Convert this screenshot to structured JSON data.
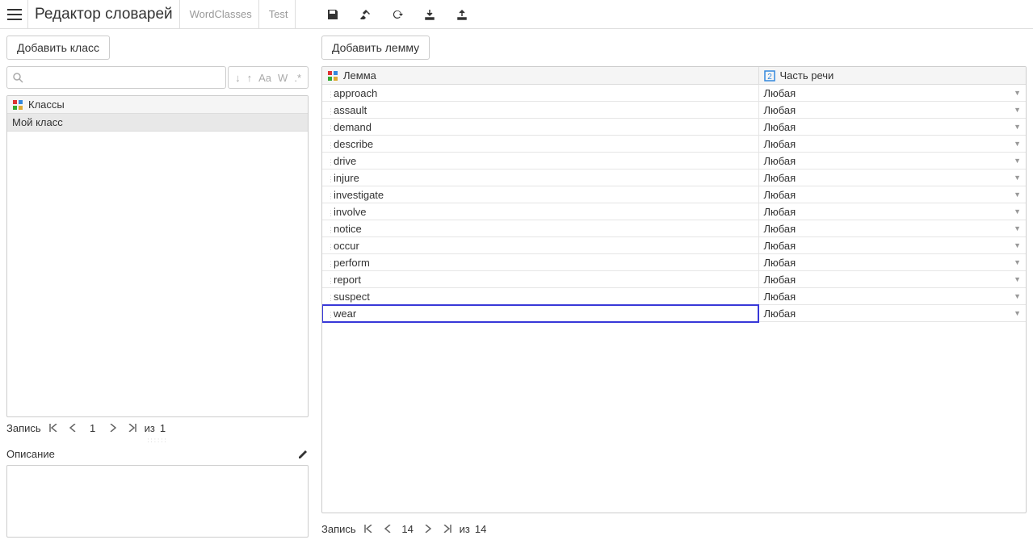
{
  "header": {
    "title": "Редактор словарей",
    "breadcrumbs": [
      "WordClasses",
      "Test"
    ]
  },
  "leftPane": {
    "addClassLabel": "Добавить класс",
    "searchIcons": {
      "down": "↓",
      "up": "↑",
      "caseToggle": "Aa",
      "wholeWord": "W",
      "regex": ".*"
    },
    "classHeader": "Классы",
    "classes": [
      "Мой класс"
    ],
    "pagination": {
      "label": "Запись",
      "current": "1",
      "totalPrefix": "из",
      "total": "1"
    },
    "descLabel": "Описание"
  },
  "rightPane": {
    "addLemmaLabel": "Добавить лемму",
    "columns": {
      "lemma": "Лемма",
      "pos": "Часть речи"
    },
    "rows": [
      {
        "lemma": "approach",
        "pos": "Любая"
      },
      {
        "lemma": "assault",
        "pos": "Любая"
      },
      {
        "lemma": "demand",
        "pos": "Любая"
      },
      {
        "lemma": "describe",
        "pos": "Любая"
      },
      {
        "lemma": "drive",
        "pos": "Любая"
      },
      {
        "lemma": "injure",
        "pos": "Любая"
      },
      {
        "lemma": "investigate",
        "pos": "Любая"
      },
      {
        "lemma": "involve",
        "pos": "Любая"
      },
      {
        "lemma": "notice",
        "pos": "Любая"
      },
      {
        "lemma": "occur",
        "pos": "Любая"
      },
      {
        "lemma": "perform",
        "pos": "Любая"
      },
      {
        "lemma": "report",
        "pos": "Любая"
      },
      {
        "lemma": "suspect",
        "pos": "Любая"
      },
      {
        "lemma": "wear",
        "pos": "Любая",
        "selected": true
      }
    ],
    "pagination": {
      "label": "Запись",
      "current": "14",
      "totalPrefix": "из",
      "total": "14"
    }
  }
}
